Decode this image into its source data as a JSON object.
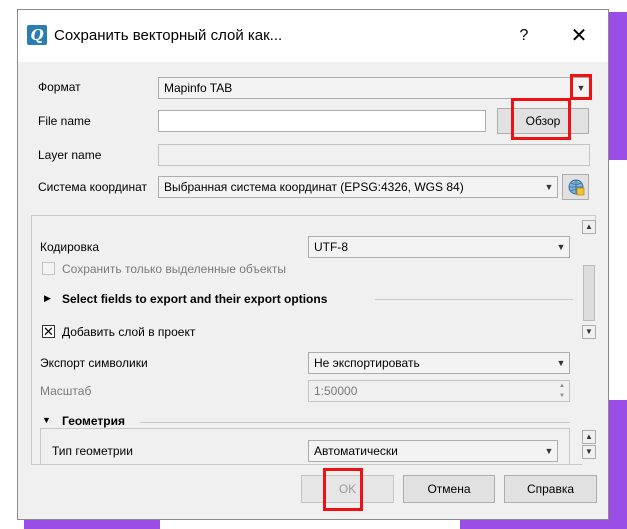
{
  "colors": {
    "background": "#9a4ee6",
    "highlight": "#ee1111"
  },
  "window": {
    "title": "Сохранить векторный слой как...",
    "help": "?",
    "close": "✕",
    "icon": "qgis-icon"
  },
  "form": {
    "format_label": "Формат",
    "format_value": "Mapinfo TAB",
    "filename_label": "File name",
    "filename_value": "",
    "browse_button": "Обзор",
    "layername_label": "Layer name",
    "layername_value": "",
    "crs_label": "Система координат",
    "crs_value": "Выбранная система координат (EPSG:4326, WGS 84)"
  },
  "options": {
    "encoding_label": "Кодировка",
    "encoding_value": "UTF-8",
    "save_selected_label": "Сохранить только выделенные объекты",
    "save_selected_checked": false,
    "select_fields_label": "Select fields to export and their export options",
    "add_layer_label": "Добавить слой в проект",
    "add_layer_checked": true,
    "symbology_label": "Экспорт символики",
    "symbology_value": "Не экспортировать",
    "scale_label": "Масштаб",
    "scale_value": "1:50000",
    "geometry_section_label": "Геометрия",
    "geometry_type_label": "Тип геометрии",
    "geometry_type_value": "Автоматически"
  },
  "buttons": {
    "ok": "OK",
    "cancel": "Отмена",
    "help": "Справка"
  }
}
